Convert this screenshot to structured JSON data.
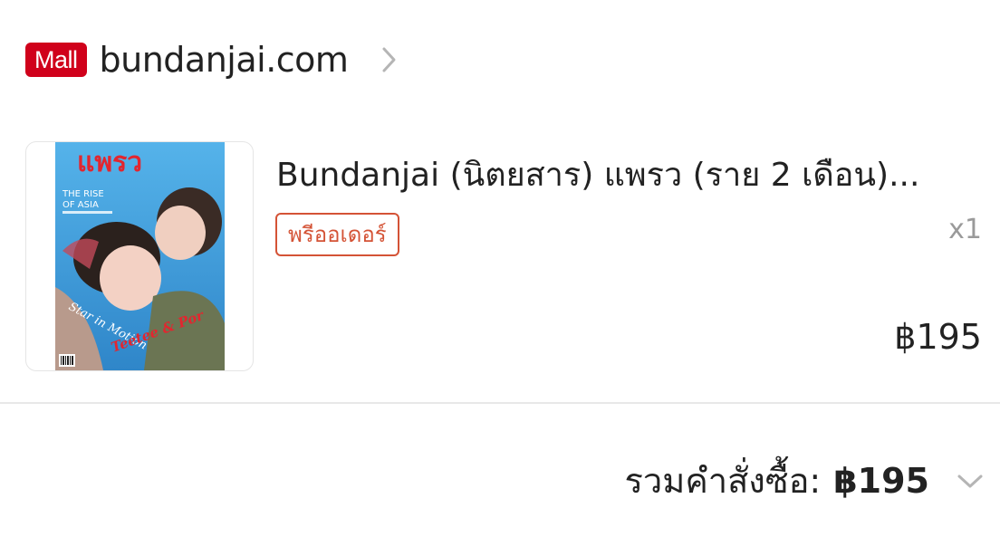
{
  "shop": {
    "badge": "Mall",
    "name": "bundanjai.com",
    "chevron_icon": "chevron-right-icon"
  },
  "item": {
    "title": "Bundanjai (นิตยสาร) แพรว (ราย 2 เดือน)...",
    "tag": "พรีออเดอร์",
    "quantity": "x1",
    "price": "฿195",
    "cover": {
      "masthead": "แพรว",
      "headline_line1": "THE RISE",
      "headline_line2": "OF ASIA",
      "script_text": "Star in Motion",
      "names": "Teetee & Por"
    }
  },
  "order": {
    "total_label": "รวมคำสั่งซื้อ:",
    "total_value": "฿195",
    "chevron_icon": "chevron-down-icon"
  },
  "colors": {
    "mall_red": "#d0011b",
    "tag_orange": "#d45336",
    "muted_gray": "#9a9a9a",
    "cover_blue": "#4aa3e0"
  }
}
